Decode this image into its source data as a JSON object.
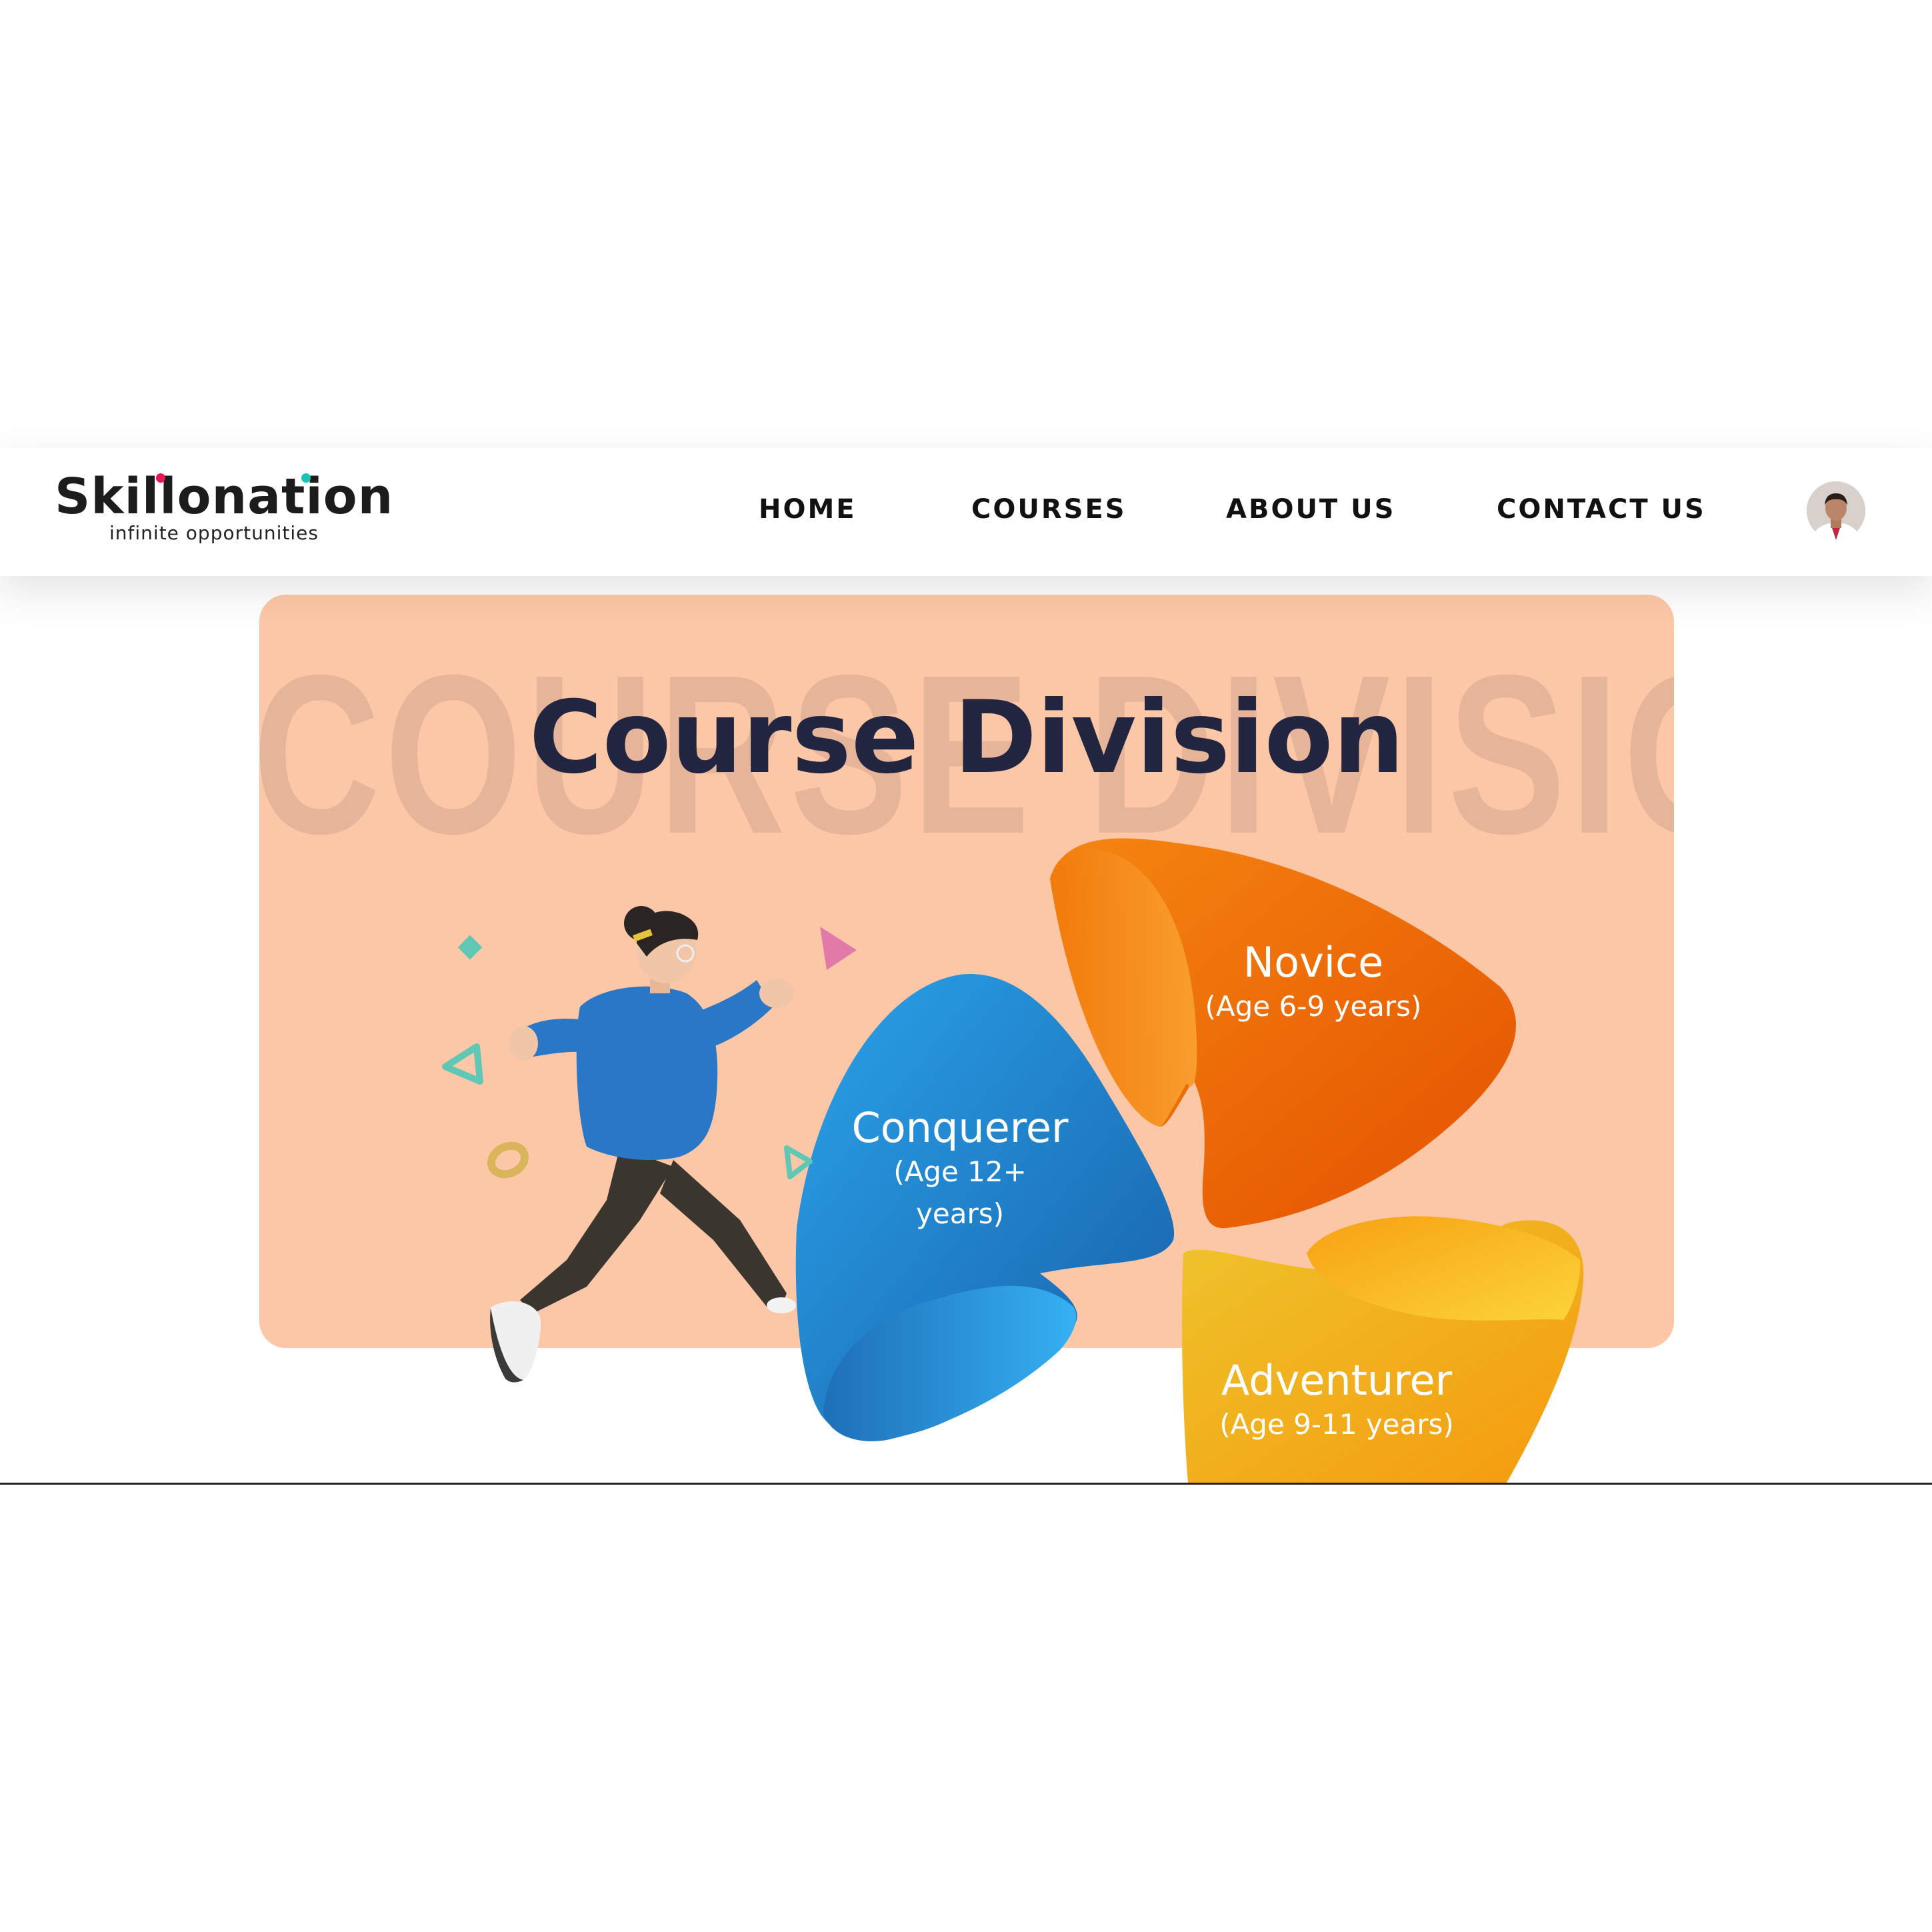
{
  "brand": {
    "name": "Skillonation",
    "tagline": "infinite opportunities"
  },
  "nav": {
    "links": [
      "HOME",
      "COURSES",
      "ABOUT US",
      "CONTACT US"
    ],
    "avatar_icon": "user-avatar"
  },
  "hero": {
    "watermark": "COURSE DIVISION",
    "title": "Course Division",
    "background": "#fcc7a6",
    "title_color": "#22253f"
  },
  "divisions": [
    {
      "name": "Novice",
      "age": "(Age 6-9 years)",
      "color": "#ec6a0c"
    },
    {
      "name": "Conquerer",
      "age": "(Age 12+ years)",
      "color": "#1f7cc4"
    },
    {
      "name": "Adventurer",
      "age": "(Age 9-11 years)",
      "color": "#f2ae1c"
    }
  ]
}
